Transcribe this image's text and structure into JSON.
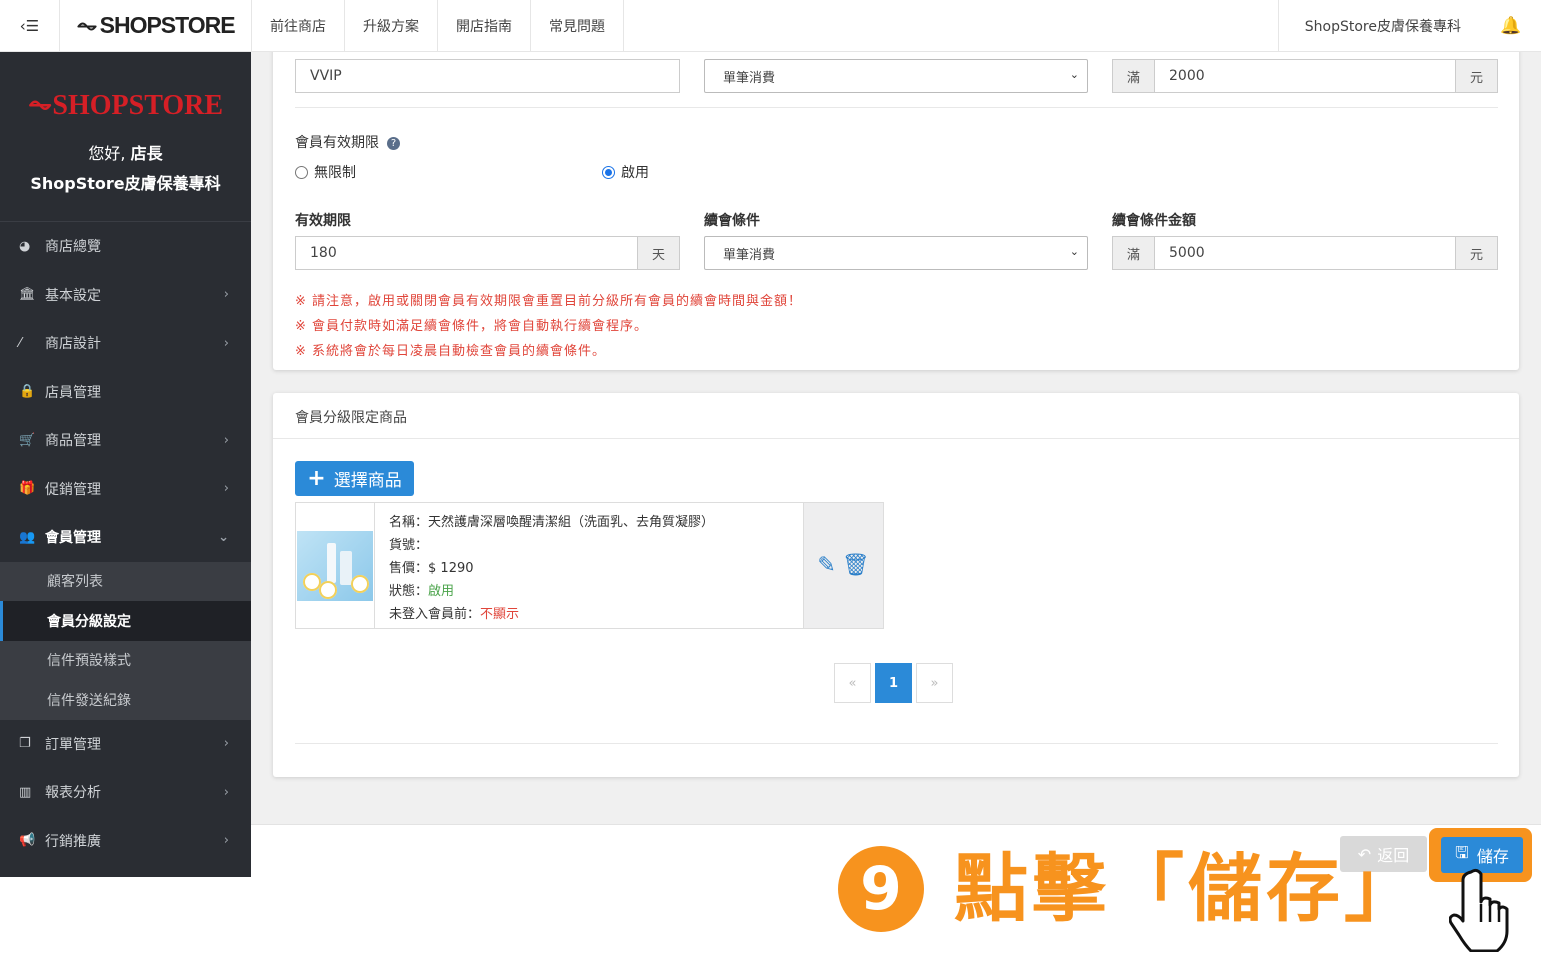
{
  "topbar": {
    "toggle_icon": "sidebar-toggle-icon",
    "logo_text": "SHOPSTORE",
    "nav": [
      "前往商店",
      "升級方案",
      "開店指南",
      "常見問題"
    ],
    "store_name": "ShopStore皮膚保養專科"
  },
  "sidebar": {
    "logo_text": "SHOPSTORE",
    "greeting_prefix": "您好,",
    "greeting_name": "店長",
    "store_name": "ShopStore皮膚保養專科",
    "items": [
      {
        "label": "商店總覽",
        "icon": "dashboard-icon",
        "chevron": ""
      },
      {
        "label": "基本設定",
        "icon": "bank-icon",
        "chevron": "›"
      },
      {
        "label": "商店設計",
        "icon": "magic-wand-icon",
        "chevron": "›"
      },
      {
        "label": "店員管理",
        "icon": "lock-icon",
        "chevron": ""
      },
      {
        "label": "商品管理",
        "icon": "cart-icon",
        "chevron": "›"
      },
      {
        "label": "促銷管理",
        "icon": "gift-icon",
        "chevron": "›"
      },
      {
        "label": "會員管理",
        "icon": "users-icon",
        "chevron": "⌄"
      },
      {
        "label": "訂單管理",
        "icon": "files-icon",
        "chevron": "›"
      },
      {
        "label": "報表分析",
        "icon": "bar-chart-icon",
        "chevron": "›"
      },
      {
        "label": "行銷推廣",
        "icon": "bullhorn-icon",
        "chevron": "›"
      }
    ],
    "submenu": [
      "顧客列表",
      "會員分級設定",
      "信件預設樣式",
      "信件發送紀錄"
    ]
  },
  "form": {
    "level_name": "VVIP",
    "upgrade_condition": "單筆消費",
    "upgrade_prefix": "滿",
    "upgrade_amount": "2000",
    "upgrade_unit": "元",
    "validity_label": "會員有效期限",
    "radio_unlimited": "無限制",
    "radio_enabled": "啟用",
    "period_label": "有效期限",
    "period_value": "180",
    "period_unit": "天",
    "renew_label": "續會條件",
    "renew_condition": "單筆消費",
    "renew_amount_label": "續會條件金額",
    "renew_prefix": "滿",
    "renew_amount": "5000",
    "renew_unit": "元",
    "notes": [
      "※ 請注意，啟用或關閉會員有效期限會重置目前分級所有會員的續會時間與金額！",
      "※ 會員付款時如滿足續會條件，將會自動執行續會程序。",
      "※ 系統將會於每日凌晨自動檢查會員的續會條件。"
    ]
  },
  "products_card": {
    "title": "會員分級限定商品",
    "choose_button": "選擇商品",
    "product": {
      "name_label": "名稱：",
      "name": "天然護膚深層喚醒清潔組（洗面乳、去角質凝膠）",
      "sku_label": "貨號：",
      "sku": "",
      "price_label": "售價：",
      "price": "$ 1290",
      "status_label": "狀態：",
      "status": "啟用",
      "guest_label": "未登入會員前：",
      "guest": "不顯示"
    },
    "pager": {
      "prev": "«",
      "current": "1",
      "next": "»"
    }
  },
  "footer": {
    "back_label": "返回",
    "save_label": "儲存"
  },
  "callout": {
    "number": "9",
    "text": "點擊「儲存」"
  },
  "colors": {
    "accent": "#2b8ad8",
    "sidebar": "#2a2d33",
    "warning": "#e0453a",
    "callout": "#f7931e",
    "brand_red": "#d61f26"
  }
}
